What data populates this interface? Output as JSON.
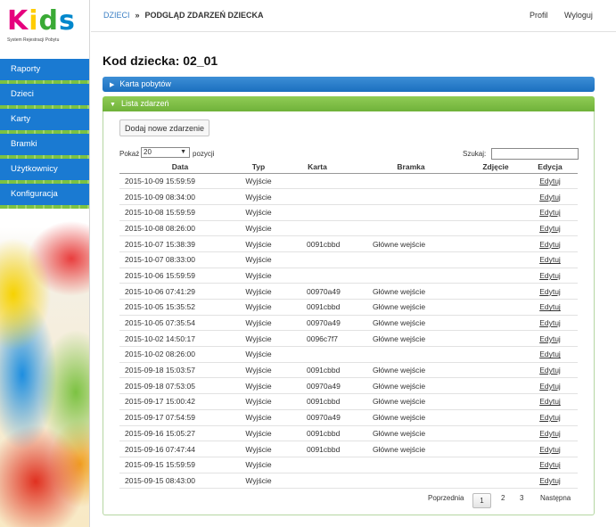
{
  "logo": {
    "letters": [
      "K",
      "i",
      "d",
      "s"
    ],
    "subtitle": "System Rejestracji Pobytu"
  },
  "nav": [
    "Raporty",
    "Dzieci",
    "Karty",
    "Bramki",
    "Użytkownicy",
    "Konfiguracja"
  ],
  "breadcrumb": {
    "parent": "DZIECI",
    "separator": "»",
    "current": "PODGLĄD ZDARZEŃ DZIECKA"
  },
  "topnav": {
    "profile": "Profil",
    "logout": "Wyloguj"
  },
  "page_title": "Kod dziecka: 02_01",
  "panels": {
    "stays": "Karta pobytów",
    "events": "Lista zdarzeń"
  },
  "add_button": "Dodaj nowe zdarzenie",
  "length": {
    "before": "Pokaż",
    "value": "20",
    "after": "pozycji"
  },
  "search": {
    "label": "Szukaj:",
    "value": ""
  },
  "columns": [
    "Data",
    "Typ",
    "Karta",
    "Bramka",
    "Zdjęcie",
    "Edycja"
  ],
  "rows": [
    {
      "date": "2015-10-09 15:59:59",
      "type": "Wyjście",
      "card": "",
      "gate": "",
      "photo": "",
      "edit": "Edytuj"
    },
    {
      "date": "2015-10-09 08:34:00",
      "type": "Wyjście",
      "card": "",
      "gate": "",
      "photo": "",
      "edit": "Edytuj"
    },
    {
      "date": "2015-10-08 15:59:59",
      "type": "Wyjście",
      "card": "",
      "gate": "",
      "photo": "",
      "edit": "Edytuj"
    },
    {
      "date": "2015-10-08 08:26:00",
      "type": "Wyjście",
      "card": "",
      "gate": "",
      "photo": "",
      "edit": "Edytuj"
    },
    {
      "date": "2015-10-07 15:38:39",
      "type": "Wyjście",
      "card": "0091cbbd",
      "gate": "Główne wejście",
      "photo": "",
      "edit": "Edytuj"
    },
    {
      "date": "2015-10-07 08:33:00",
      "type": "Wyjście",
      "card": "",
      "gate": "",
      "photo": "",
      "edit": "Edytuj"
    },
    {
      "date": "2015-10-06 15:59:59",
      "type": "Wyjście",
      "card": "",
      "gate": "",
      "photo": "",
      "edit": "Edytuj"
    },
    {
      "date": "2015-10-06 07:41:29",
      "type": "Wyjście",
      "card": "00970a49",
      "gate": "Główne wejście",
      "photo": "",
      "edit": "Edytuj"
    },
    {
      "date": "2015-10-05 15:35:52",
      "type": "Wyjście",
      "card": "0091cbbd",
      "gate": "Główne wejście",
      "photo": "",
      "edit": "Edytuj"
    },
    {
      "date": "2015-10-05 07:35:54",
      "type": "Wyjście",
      "card": "00970a49",
      "gate": "Główne wejście",
      "photo": "",
      "edit": "Edytuj"
    },
    {
      "date": "2015-10-02 14:50:17",
      "type": "Wyjście",
      "card": "0096c7f7",
      "gate": "Główne wejście",
      "photo": "",
      "edit": "Edytuj"
    },
    {
      "date": "2015-10-02 08:26:00",
      "type": "Wyjście",
      "card": "",
      "gate": "",
      "photo": "",
      "edit": "Edytuj"
    },
    {
      "date": "2015-09-18 15:03:57",
      "type": "Wyjście",
      "card": "0091cbbd",
      "gate": "Główne wejście",
      "photo": "",
      "edit": "Edytuj"
    },
    {
      "date": "2015-09-18 07:53:05",
      "type": "Wyjście",
      "card": "00970a49",
      "gate": "Główne wejście",
      "photo": "",
      "edit": "Edytuj"
    },
    {
      "date": "2015-09-17 15:00:42",
      "type": "Wyjście",
      "card": "0091cbbd",
      "gate": "Główne wejście",
      "photo": "",
      "edit": "Edytuj"
    },
    {
      "date": "2015-09-17 07:54:59",
      "type": "Wyjście",
      "card": "00970a49",
      "gate": "Główne wejście",
      "photo": "",
      "edit": "Edytuj"
    },
    {
      "date": "2015-09-16 15:05:27",
      "type": "Wyjście",
      "card": "0091cbbd",
      "gate": "Główne wejście",
      "photo": "",
      "edit": "Edytuj"
    },
    {
      "date": "2015-09-16 07:47:44",
      "type": "Wyjście",
      "card": "0091cbbd",
      "gate": "Główne wejście",
      "photo": "",
      "edit": "Edytuj"
    },
    {
      "date": "2015-09-15 15:59:59",
      "type": "Wyjście",
      "card": "",
      "gate": "",
      "photo": "",
      "edit": "Edytuj"
    },
    {
      "date": "2015-09-15 08:43:00",
      "type": "Wyjście",
      "card": "",
      "gate": "",
      "photo": "",
      "edit": "Edytuj"
    }
  ],
  "pagination": {
    "prev": "Poprzednia",
    "pages": [
      "1",
      "2",
      "3"
    ],
    "current": "1",
    "next": "Następna"
  },
  "colors": {
    "nav_blue": "#1a7ad2",
    "nav_green": "#7cc242",
    "panel_blue": "#2b7fcb",
    "panel_green": "#7cbf45"
  }
}
